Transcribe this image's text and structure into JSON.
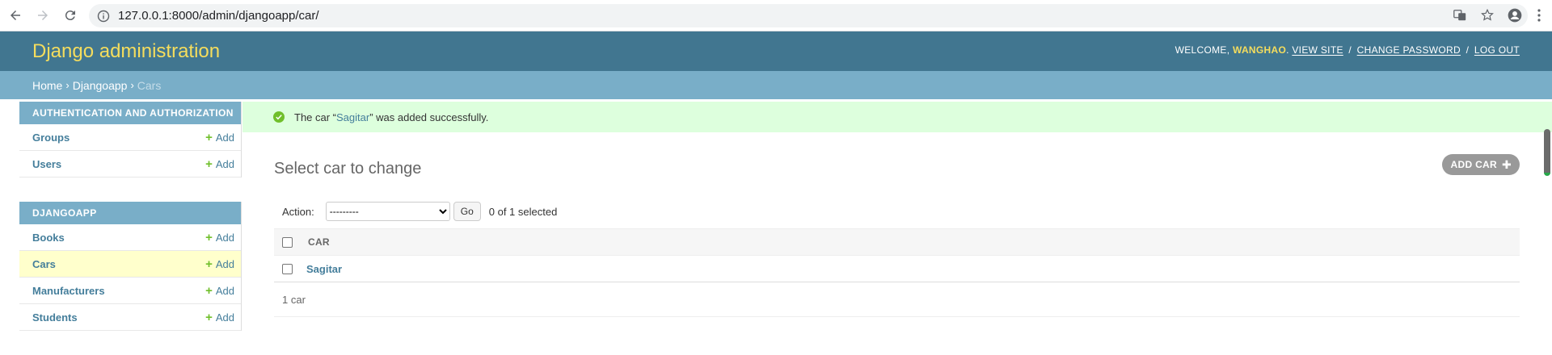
{
  "browser": {
    "url": "127.0.0.1:8000/admin/djangoapp/car/"
  },
  "header": {
    "branding": "Django administration",
    "welcome": "WELCOME,",
    "username": "WANGHAO",
    "view_site": "VIEW SITE",
    "change_password": "CHANGE PASSWORD",
    "log_out": "LOG OUT",
    "sep": "/"
  },
  "breadcrumbs": {
    "home": "Home",
    "app": "Djangoapp",
    "current": "Cars",
    "sep": "›"
  },
  "sidebar": {
    "modules": [
      {
        "caption": "AUTHENTICATION AND AUTHORIZATION",
        "items": [
          {
            "label": "Groups",
            "add": "Add"
          },
          {
            "label": "Users",
            "add": "Add"
          }
        ]
      },
      {
        "caption": "DJANGOAPP",
        "items": [
          {
            "label": "Books",
            "add": "Add"
          },
          {
            "label": "Cars",
            "add": "Add"
          },
          {
            "label": "Manufacturers",
            "add": "Add"
          },
          {
            "label": "Students",
            "add": "Add"
          }
        ]
      }
    ]
  },
  "message": {
    "prefix": "The car “",
    "object": "Sagitar",
    "suffix": "” was added successfully."
  },
  "main": {
    "title": "Select car to change",
    "add_button": "ADD CAR",
    "action_label": "Action:",
    "action_selected": "---------",
    "go_button": "Go",
    "selected_count": "0 of 1 selected",
    "column_header": "CAR",
    "rows": [
      "Sagitar"
    ],
    "paginator": "1 car"
  },
  "colors": {
    "header_bg": "#417690",
    "breadcrumbs_bg": "#79aec8",
    "branding": "#f5dd5d",
    "success_bg": "#dfd",
    "link": "#447e9b",
    "add_green": "#70bf2b"
  }
}
